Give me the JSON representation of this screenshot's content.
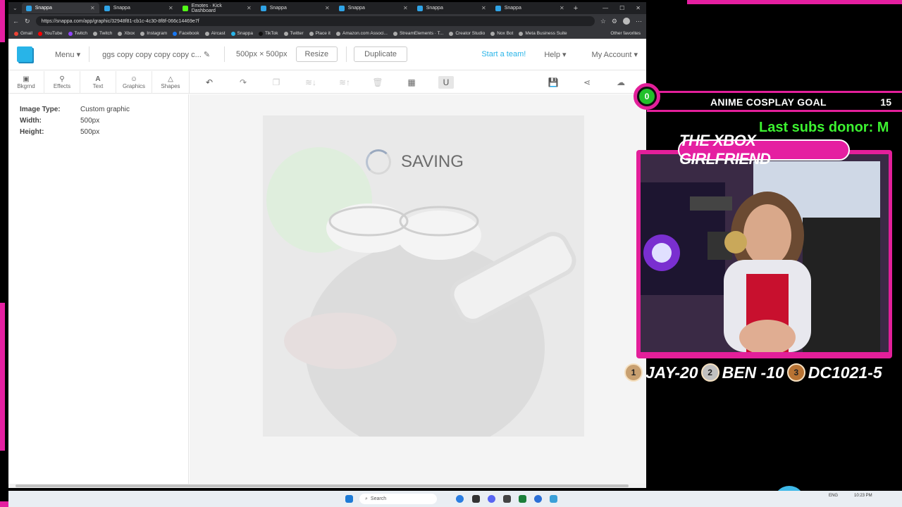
{
  "browser": {
    "tabs": [
      {
        "label": "Snappa",
        "active": true
      },
      {
        "label": "Snappa",
        "active": false
      },
      {
        "label": "Emotes · Kick Dashboard",
        "active": false
      },
      {
        "label": "Snappa",
        "active": false
      },
      {
        "label": "Snappa",
        "active": false
      },
      {
        "label": "Snappa",
        "active": false
      },
      {
        "label": "Snappa",
        "active": false
      }
    ],
    "url": "https://snappa.com/app/graphic/32948f81-cb1c-4c30-8f8f-066c14469e7f",
    "bookmarks": [
      "Gmail",
      "YouTube",
      "Twitch",
      "Twitch",
      "Xbox",
      "Instagram",
      "Facebook",
      "Aircast",
      "Snappa",
      "TikTok",
      "Twitter",
      "Place it",
      "Amazon.com Associ...",
      "StreamElements · T...",
      "Creator Studio",
      "Nox Bot",
      "Meta Business Suite"
    ],
    "other_favorites": "Other favorites"
  },
  "app": {
    "menu_label": "Menu",
    "doc_title": "ggs copy copy copy copy c...",
    "dimensions": "500px × 500px",
    "resize_label": "Resize",
    "duplicate_label": "Duplicate",
    "start_team_label": "Start a team!",
    "help_label": "Help",
    "account_label": "My Account",
    "left_tools": [
      {
        "label": "Bkgrnd",
        "icon": "image-icon"
      },
      {
        "label": "Effects",
        "icon": "wand-icon"
      },
      {
        "label": "Text",
        "icon": "text-icon"
      },
      {
        "label": "Graphics",
        "icon": "smiley-icon"
      },
      {
        "label": "Shapes",
        "icon": "triangle-icon"
      }
    ],
    "props": {
      "image_type_label": "Image Type:",
      "image_type_value": "Custom graphic",
      "width_label": "Width:",
      "width_value": "500px",
      "height_label": "Height:",
      "height_value": "500px"
    },
    "saving_label": "SAVING",
    "accent": "#28b4e8"
  },
  "taskbar": {
    "search_label": "Search",
    "lang": "ENG",
    "time": "10:23 PM"
  },
  "overlay": {
    "goal_count": "0",
    "goal_title": "ANIME COSPLAY GOAL",
    "goal_target": "15",
    "ticker": "Last subs donor: M",
    "name_banner": "THE XBOX GIRLFRIEND",
    "leaders": [
      {
        "rank": "1",
        "text": "JAY-20"
      },
      {
        "rank": "2",
        "text": "BEN -10"
      },
      {
        "rank": "3",
        "text": "DC1021-5"
      }
    ],
    "pink": "#e31f9a",
    "green": "#3cf230"
  }
}
